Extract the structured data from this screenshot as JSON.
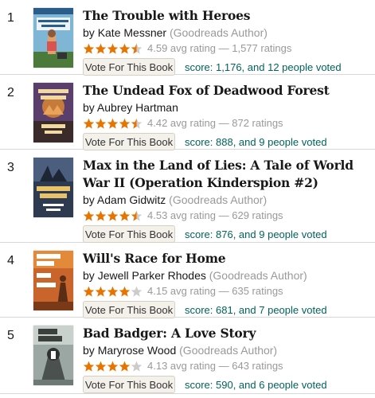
{
  "vote_label": "Vote For This Book",
  "star_color": "#e87400",
  "star_empty": "#cccccc",
  "books": [
    {
      "rank": "1",
      "title": "The Trouble with Heroes",
      "by": "by",
      "author": "Kate Messner",
      "goodreads_author": "(Goodreads Author)",
      "stars": 4.5,
      "rating_text": "4.59 avg rating — 1,577 ratings",
      "score_prefix": "score: 1,176",
      "score_and": ", and",
      "voters": "12 people voted",
      "cover_title": "The Trouble with Heroes",
      "cover_author": "KATE MESSNER"
    },
    {
      "rank": "2",
      "title": "The Undead Fox of Deadwood Forest",
      "by": "by",
      "author": "Aubrey Hartman",
      "goodreads_author": "",
      "stars": 4.5,
      "rating_text": "4.42 avg rating — 872 ratings",
      "score_prefix": "score: 888",
      "score_and": ", and",
      "voters": "9 people voted",
      "cover_title": "The Undead Fox of Deadwood Forest",
      "cover_author": ""
    },
    {
      "rank": "3",
      "title": "Max in the Land of Lies: A Tale of World War II (Operation Kinderspion #2)",
      "by": "by",
      "author": "Adam Gidwitz",
      "goodreads_author": "(Goodreads Author)",
      "stars": 4.5,
      "rating_text": "4.53 avg rating — 629 ratings",
      "score_prefix": "score: 876",
      "score_and": ", and",
      "voters": "9 people voted",
      "cover_title": "Max in the Land of Lies",
      "cover_author": "Adam Gidwitz"
    },
    {
      "rank": "4",
      "title": "Will's Race for Home",
      "by": "by",
      "author": "Jewell Parker Rhodes",
      "goodreads_author": "(Goodreads Author)",
      "stars": 4.0,
      "rating_text": "4.15 avg rating — 635 ratings",
      "score_prefix": "score: 681",
      "score_and": ", and",
      "voters": "7 people voted",
      "cover_title": "Will's Race for Home",
      "cover_author": "Jewell Parker Rhodes"
    },
    {
      "rank": "5",
      "title": "Bad Badger: A Love Story",
      "by": "by",
      "author": "Maryrose Wood",
      "goodreads_author": "(Goodreads Author)",
      "stars": 4.0,
      "rating_text": "4.13 avg rating — 643 ratings",
      "score_prefix": "score: 590",
      "score_and": ", and",
      "voters": "6 people voted",
      "cover_title": "Bad Badger",
      "cover_author": ""
    }
  ]
}
